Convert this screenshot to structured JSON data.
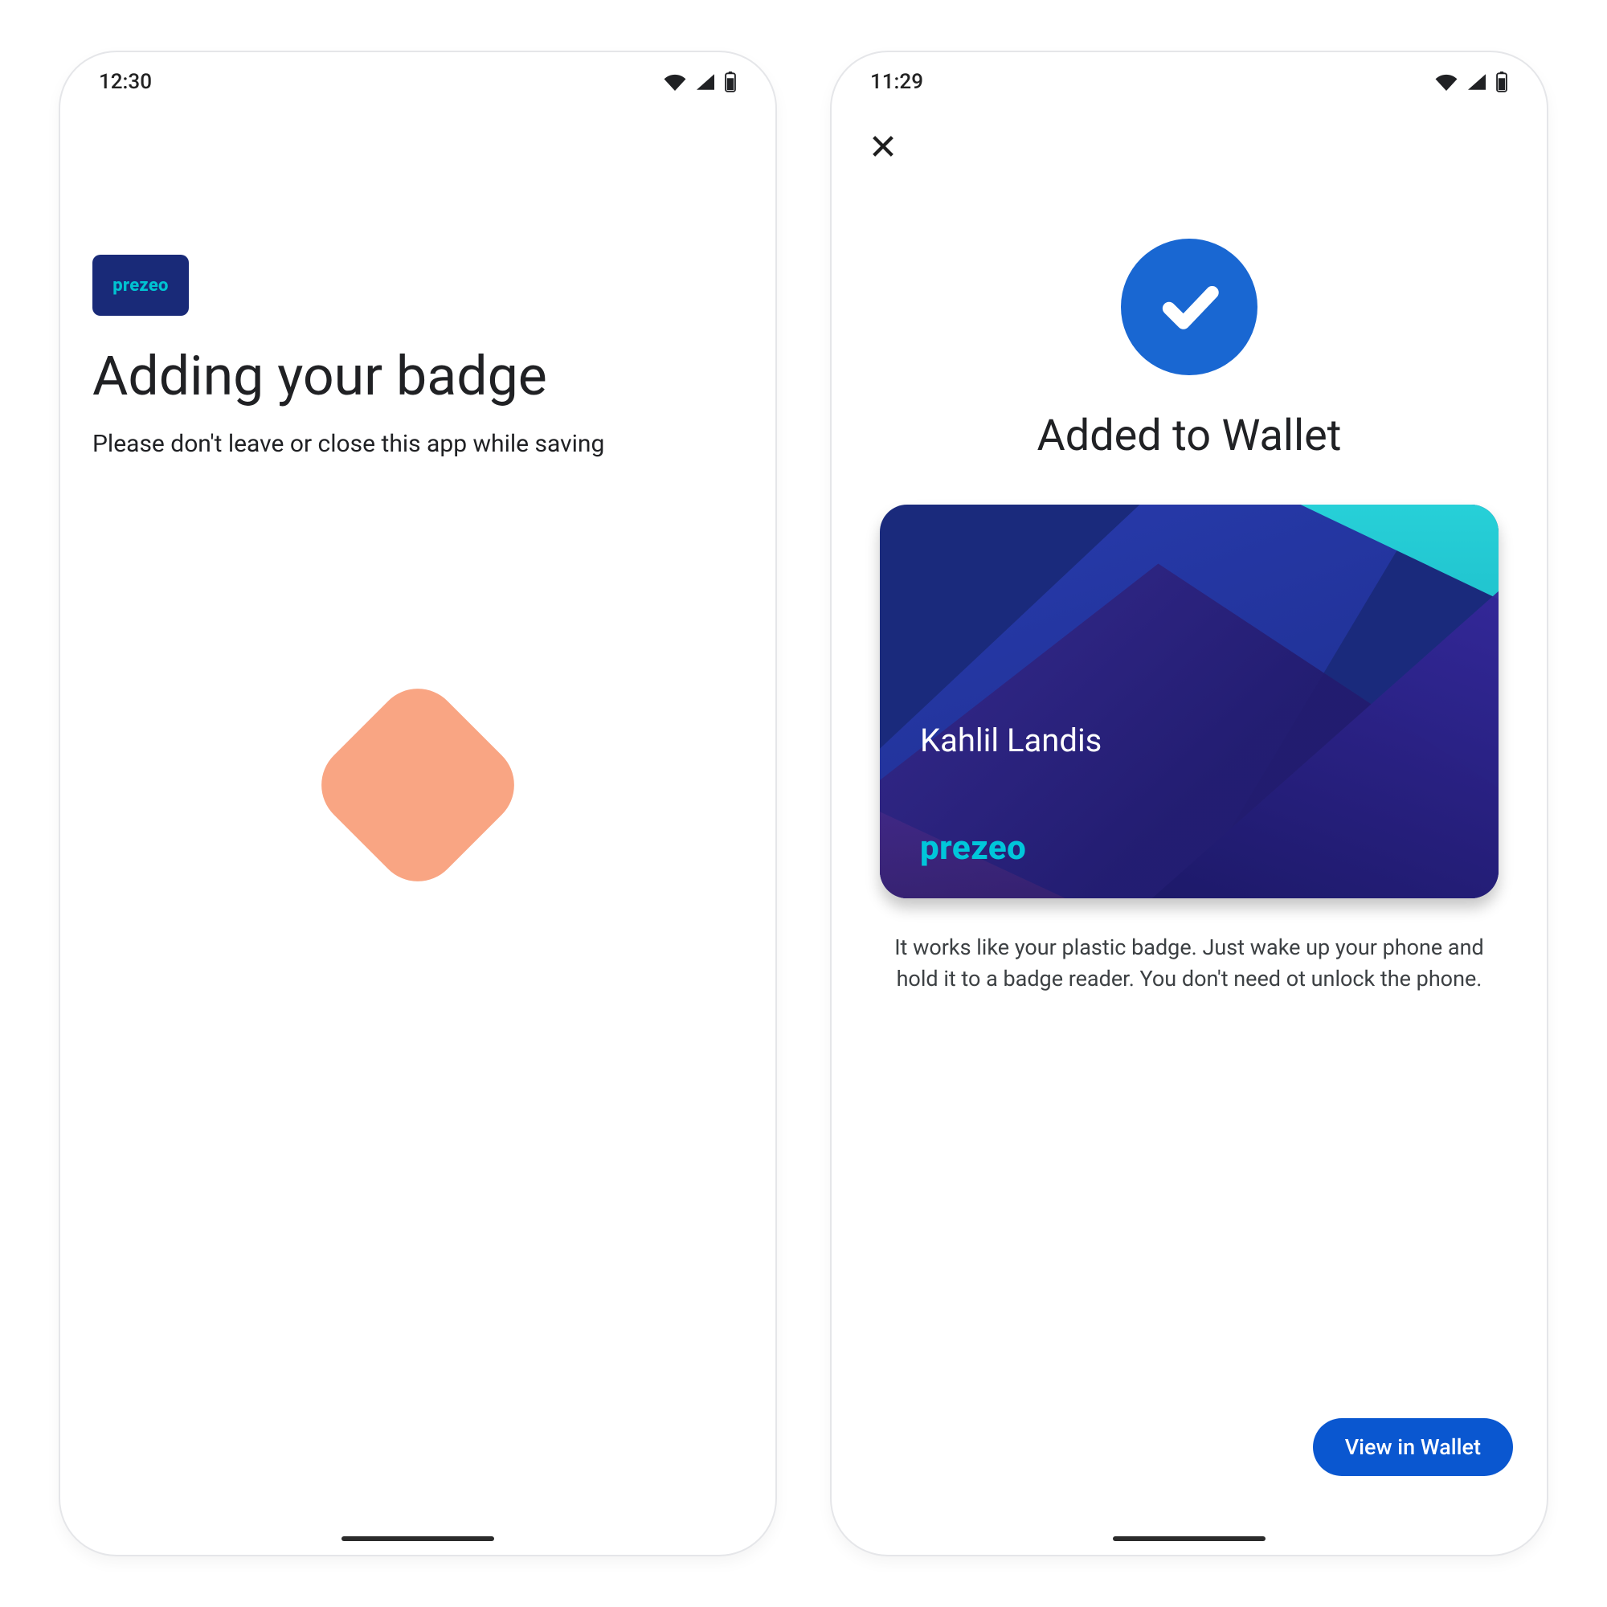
{
  "phoneA": {
    "status_time": "12:30",
    "brand_name": "prezeo",
    "title": "Adding your badge",
    "subtitle": "Please don't leave or close this app while saving"
  },
  "phoneB": {
    "status_time": "11:29",
    "title": "Added to Wallet",
    "card": {
      "name": "Kahlil Landis",
      "brand": "prezeo"
    },
    "description": "It works like your plastic badge. Just wake up your phone and hold it to a badge reader. You don't need ot unlock the phone.",
    "cta_label": "View in Wallet"
  }
}
